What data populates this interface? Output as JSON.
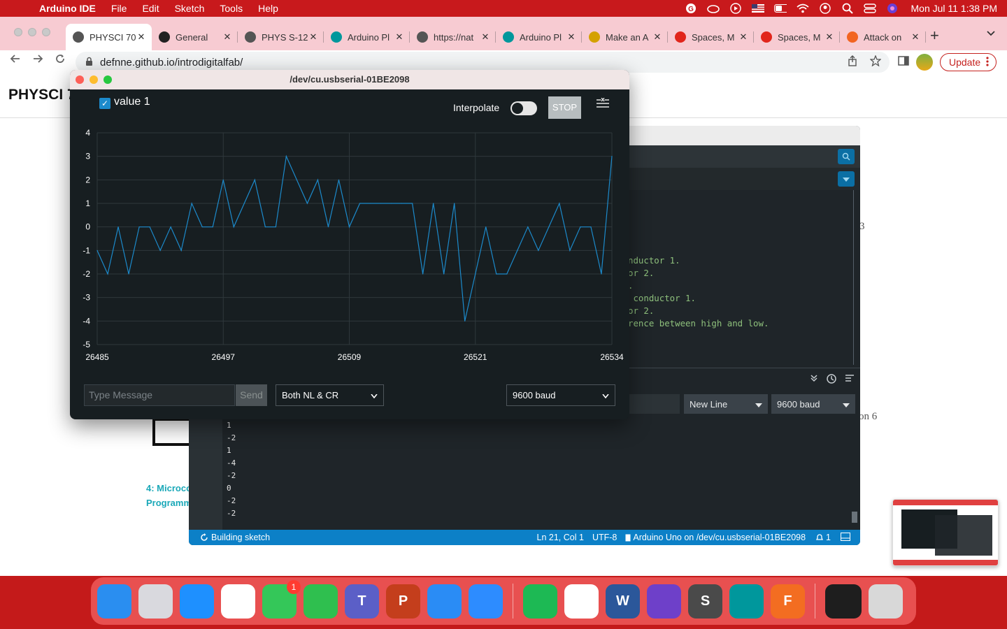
{
  "menubar": {
    "app": "Arduino IDE",
    "items": [
      "File",
      "Edit",
      "Sketch",
      "Tools",
      "Help"
    ],
    "clock": "Mon Jul 11  1:38 PM"
  },
  "browser": {
    "tabs": [
      {
        "title": "PHYSCI 70",
        "fav_color": "#555555"
      },
      {
        "title": "General",
        "fav_color": "#222222"
      },
      {
        "title": "PHYS S-12",
        "fav_color": "#555555"
      },
      {
        "title": "Arduino Pl",
        "fav_color": "#00979c"
      },
      {
        "title": "https://nat",
        "fav_color": "#555555"
      },
      {
        "title": "Arduino Pl",
        "fav_color": "#00979c"
      },
      {
        "title": "Make an A",
        "fav_color": "#d4a100"
      },
      {
        "title": "Spaces, M",
        "fav_color": "#e1251b"
      },
      {
        "title": "Spaces, M",
        "fav_color": "#e1251b"
      },
      {
        "title": "Attack on",
        "fav_color": "#f26522"
      }
    ],
    "url": "defnne.github.io/introdigitalfab/",
    "update_label": "Update"
  },
  "page": {
    "title": "PHYSCI 7",
    "card_label_line1": "4: Microco",
    "card_label_line2": "Programm",
    "side_text_1": "3",
    "side_text_2": "on 6"
  },
  "ide": {
    "code_lines": [
      "nductor 1.",
      "or 2.",
      ".",
      " conductor 1.",
      "or 2.",
      "rence between high and low."
    ],
    "line_ending": "New Line",
    "baud": "9600 baud",
    "output_lines": [
      "1",
      "-2",
      "1",
      "-4",
      "-2",
      "0",
      "-2",
      "-2"
    ],
    "status_left": "Building sketch",
    "status_pos": "Ln 21, Col 1",
    "status_enc": "UTF-8",
    "status_board": "Arduino Uno on /dev/cu.usbserial-01BE2098",
    "status_count": "1"
  },
  "plotter": {
    "title": "/dev/cu.usbserial-01BE2098",
    "series_label": "value 1",
    "interpolate_label": "Interpolate",
    "stop_label": "STOP",
    "message_placeholder": "Type Message",
    "send_label": "Send",
    "line_ending": "Both NL & CR",
    "baud": "9600 baud"
  },
  "chart_data": {
    "type": "line",
    "title": "",
    "xlabel": "",
    "ylabel": "",
    "xlim": [
      26485,
      26534
    ],
    "ylim": [
      -5,
      4
    ],
    "x_ticks": [
      26485,
      26497,
      26509,
      26521,
      26534
    ],
    "y_ticks": [
      4,
      3,
      2,
      1,
      0,
      -1,
      -2,
      -3,
      -4,
      -5
    ],
    "grid": true,
    "series": [
      {
        "name": "value 1",
        "color": "#1c8acb",
        "x": [
          26485,
          26486,
          26487,
          26488,
          26489,
          26490,
          26491,
          26492,
          26493,
          26494,
          26495,
          26496,
          26497,
          26498,
          26499,
          26500,
          26501,
          26502,
          26503,
          26504,
          26505,
          26506,
          26507,
          26508,
          26509,
          26510,
          26511,
          26512,
          26513,
          26514,
          26515,
          26516,
          26517,
          26518,
          26519,
          26520,
          26521,
          26522,
          26523,
          26524,
          26525,
          26526,
          26527,
          26528,
          26529,
          26530,
          26531,
          26532,
          26533,
          26534
        ],
        "values": [
          -1,
          -2,
          0,
          -2,
          0,
          0,
          -1,
          0,
          -1,
          1,
          0,
          0,
          2,
          0,
          1,
          2,
          0,
          0,
          3,
          2,
          1,
          2,
          0,
          2,
          0,
          1,
          1,
          1,
          1,
          1,
          1,
          -2,
          1,
          -2,
          1,
          -4,
          -2,
          0,
          -2,
          -2,
          -1,
          0,
          -1,
          0,
          1,
          -1,
          0,
          0,
          -2,
          3
        ]
      }
    ]
  },
  "dock": {
    "apps": [
      {
        "name": "finder",
        "color": "#2a8ef0",
        "glyph": ""
      },
      {
        "name": "launchpad",
        "color": "#d9d9de",
        "glyph": ""
      },
      {
        "name": "safari",
        "color": "#1e90ff",
        "glyph": ""
      },
      {
        "name": "photos",
        "color": "#ffffff",
        "glyph": ""
      },
      {
        "name": "messages",
        "color": "#34c759",
        "glyph": "",
        "badge": "1"
      },
      {
        "name": "facetime",
        "color": "#2fbf4f",
        "glyph": ""
      },
      {
        "name": "teams",
        "color": "#5b5fc7",
        "glyph": "T"
      },
      {
        "name": "powerpoint",
        "color": "#c43e1c",
        "glyph": "P"
      },
      {
        "name": "mail",
        "color": "#2a8cf5",
        "glyph": ""
      },
      {
        "name": "zoom",
        "color": "#2d8cff",
        "glyph": ""
      },
      {
        "name": "spotify",
        "color": "#1db954",
        "glyph": ""
      },
      {
        "name": "chrome",
        "color": "#ffffff",
        "glyph": ""
      },
      {
        "name": "word",
        "color": "#2b579a",
        "glyph": "W"
      },
      {
        "name": "github-desktop",
        "color": "#6e40c9",
        "glyph": ""
      },
      {
        "name": "sublime-text",
        "color": "#4a4a4a",
        "glyph": "S"
      },
      {
        "name": "arduino",
        "color": "#00979c",
        "glyph": ""
      },
      {
        "name": "fusion-360",
        "color": "#f36d21",
        "glyph": "F"
      }
    ]
  }
}
